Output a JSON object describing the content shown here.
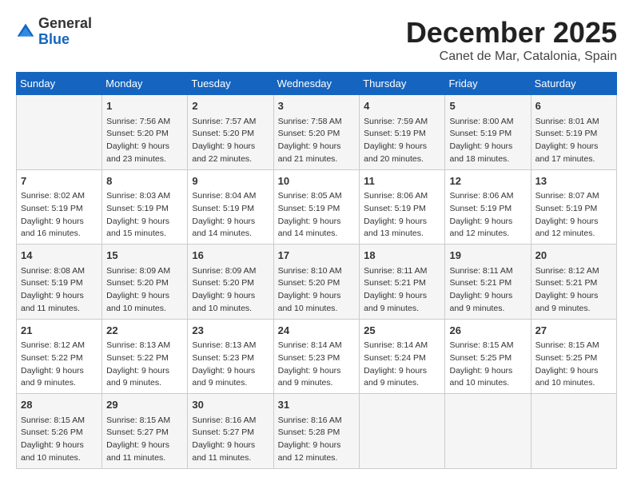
{
  "header": {
    "logo_general": "General",
    "logo_blue": "Blue",
    "title": "December 2025",
    "subtitle": "Canet de Mar, Catalonia, Spain"
  },
  "calendar": {
    "days_of_week": [
      "Sunday",
      "Monday",
      "Tuesday",
      "Wednesday",
      "Thursday",
      "Friday",
      "Saturday"
    ],
    "weeks": [
      [
        {
          "day": "",
          "info": ""
        },
        {
          "day": "1",
          "info": "Sunrise: 7:56 AM\nSunset: 5:20 PM\nDaylight: 9 hours\nand 23 minutes."
        },
        {
          "day": "2",
          "info": "Sunrise: 7:57 AM\nSunset: 5:20 PM\nDaylight: 9 hours\nand 22 minutes."
        },
        {
          "day": "3",
          "info": "Sunrise: 7:58 AM\nSunset: 5:20 PM\nDaylight: 9 hours\nand 21 minutes."
        },
        {
          "day": "4",
          "info": "Sunrise: 7:59 AM\nSunset: 5:19 PM\nDaylight: 9 hours\nand 20 minutes."
        },
        {
          "day": "5",
          "info": "Sunrise: 8:00 AM\nSunset: 5:19 PM\nDaylight: 9 hours\nand 18 minutes."
        },
        {
          "day": "6",
          "info": "Sunrise: 8:01 AM\nSunset: 5:19 PM\nDaylight: 9 hours\nand 17 minutes."
        }
      ],
      [
        {
          "day": "7",
          "info": "Sunrise: 8:02 AM\nSunset: 5:19 PM\nDaylight: 9 hours\nand 16 minutes."
        },
        {
          "day": "8",
          "info": "Sunrise: 8:03 AM\nSunset: 5:19 PM\nDaylight: 9 hours\nand 15 minutes."
        },
        {
          "day": "9",
          "info": "Sunrise: 8:04 AM\nSunset: 5:19 PM\nDaylight: 9 hours\nand 14 minutes."
        },
        {
          "day": "10",
          "info": "Sunrise: 8:05 AM\nSunset: 5:19 PM\nDaylight: 9 hours\nand 14 minutes."
        },
        {
          "day": "11",
          "info": "Sunrise: 8:06 AM\nSunset: 5:19 PM\nDaylight: 9 hours\nand 13 minutes."
        },
        {
          "day": "12",
          "info": "Sunrise: 8:06 AM\nSunset: 5:19 PM\nDaylight: 9 hours\nand 12 minutes."
        },
        {
          "day": "13",
          "info": "Sunrise: 8:07 AM\nSunset: 5:19 PM\nDaylight: 9 hours\nand 12 minutes."
        }
      ],
      [
        {
          "day": "14",
          "info": "Sunrise: 8:08 AM\nSunset: 5:19 PM\nDaylight: 9 hours\nand 11 minutes."
        },
        {
          "day": "15",
          "info": "Sunrise: 8:09 AM\nSunset: 5:20 PM\nDaylight: 9 hours\nand 10 minutes."
        },
        {
          "day": "16",
          "info": "Sunrise: 8:09 AM\nSunset: 5:20 PM\nDaylight: 9 hours\nand 10 minutes."
        },
        {
          "day": "17",
          "info": "Sunrise: 8:10 AM\nSunset: 5:20 PM\nDaylight: 9 hours\nand 10 minutes."
        },
        {
          "day": "18",
          "info": "Sunrise: 8:11 AM\nSunset: 5:21 PM\nDaylight: 9 hours\nand 9 minutes."
        },
        {
          "day": "19",
          "info": "Sunrise: 8:11 AM\nSunset: 5:21 PM\nDaylight: 9 hours\nand 9 minutes."
        },
        {
          "day": "20",
          "info": "Sunrise: 8:12 AM\nSunset: 5:21 PM\nDaylight: 9 hours\nand 9 minutes."
        }
      ],
      [
        {
          "day": "21",
          "info": "Sunrise: 8:12 AM\nSunset: 5:22 PM\nDaylight: 9 hours\nand 9 minutes."
        },
        {
          "day": "22",
          "info": "Sunrise: 8:13 AM\nSunset: 5:22 PM\nDaylight: 9 hours\nand 9 minutes."
        },
        {
          "day": "23",
          "info": "Sunrise: 8:13 AM\nSunset: 5:23 PM\nDaylight: 9 hours\nand 9 minutes."
        },
        {
          "day": "24",
          "info": "Sunrise: 8:14 AM\nSunset: 5:23 PM\nDaylight: 9 hours\nand 9 minutes."
        },
        {
          "day": "25",
          "info": "Sunrise: 8:14 AM\nSunset: 5:24 PM\nDaylight: 9 hours\nand 9 minutes."
        },
        {
          "day": "26",
          "info": "Sunrise: 8:15 AM\nSunset: 5:25 PM\nDaylight: 9 hours\nand 10 minutes."
        },
        {
          "day": "27",
          "info": "Sunrise: 8:15 AM\nSunset: 5:25 PM\nDaylight: 9 hours\nand 10 minutes."
        }
      ],
      [
        {
          "day": "28",
          "info": "Sunrise: 8:15 AM\nSunset: 5:26 PM\nDaylight: 9 hours\nand 10 minutes."
        },
        {
          "day": "29",
          "info": "Sunrise: 8:15 AM\nSunset: 5:27 PM\nDaylight: 9 hours\nand 11 minutes."
        },
        {
          "day": "30",
          "info": "Sunrise: 8:16 AM\nSunset: 5:27 PM\nDaylight: 9 hours\nand 11 minutes."
        },
        {
          "day": "31",
          "info": "Sunrise: 8:16 AM\nSunset: 5:28 PM\nDaylight: 9 hours\nand 12 minutes."
        },
        {
          "day": "",
          "info": ""
        },
        {
          "day": "",
          "info": ""
        },
        {
          "day": "",
          "info": ""
        }
      ]
    ]
  }
}
